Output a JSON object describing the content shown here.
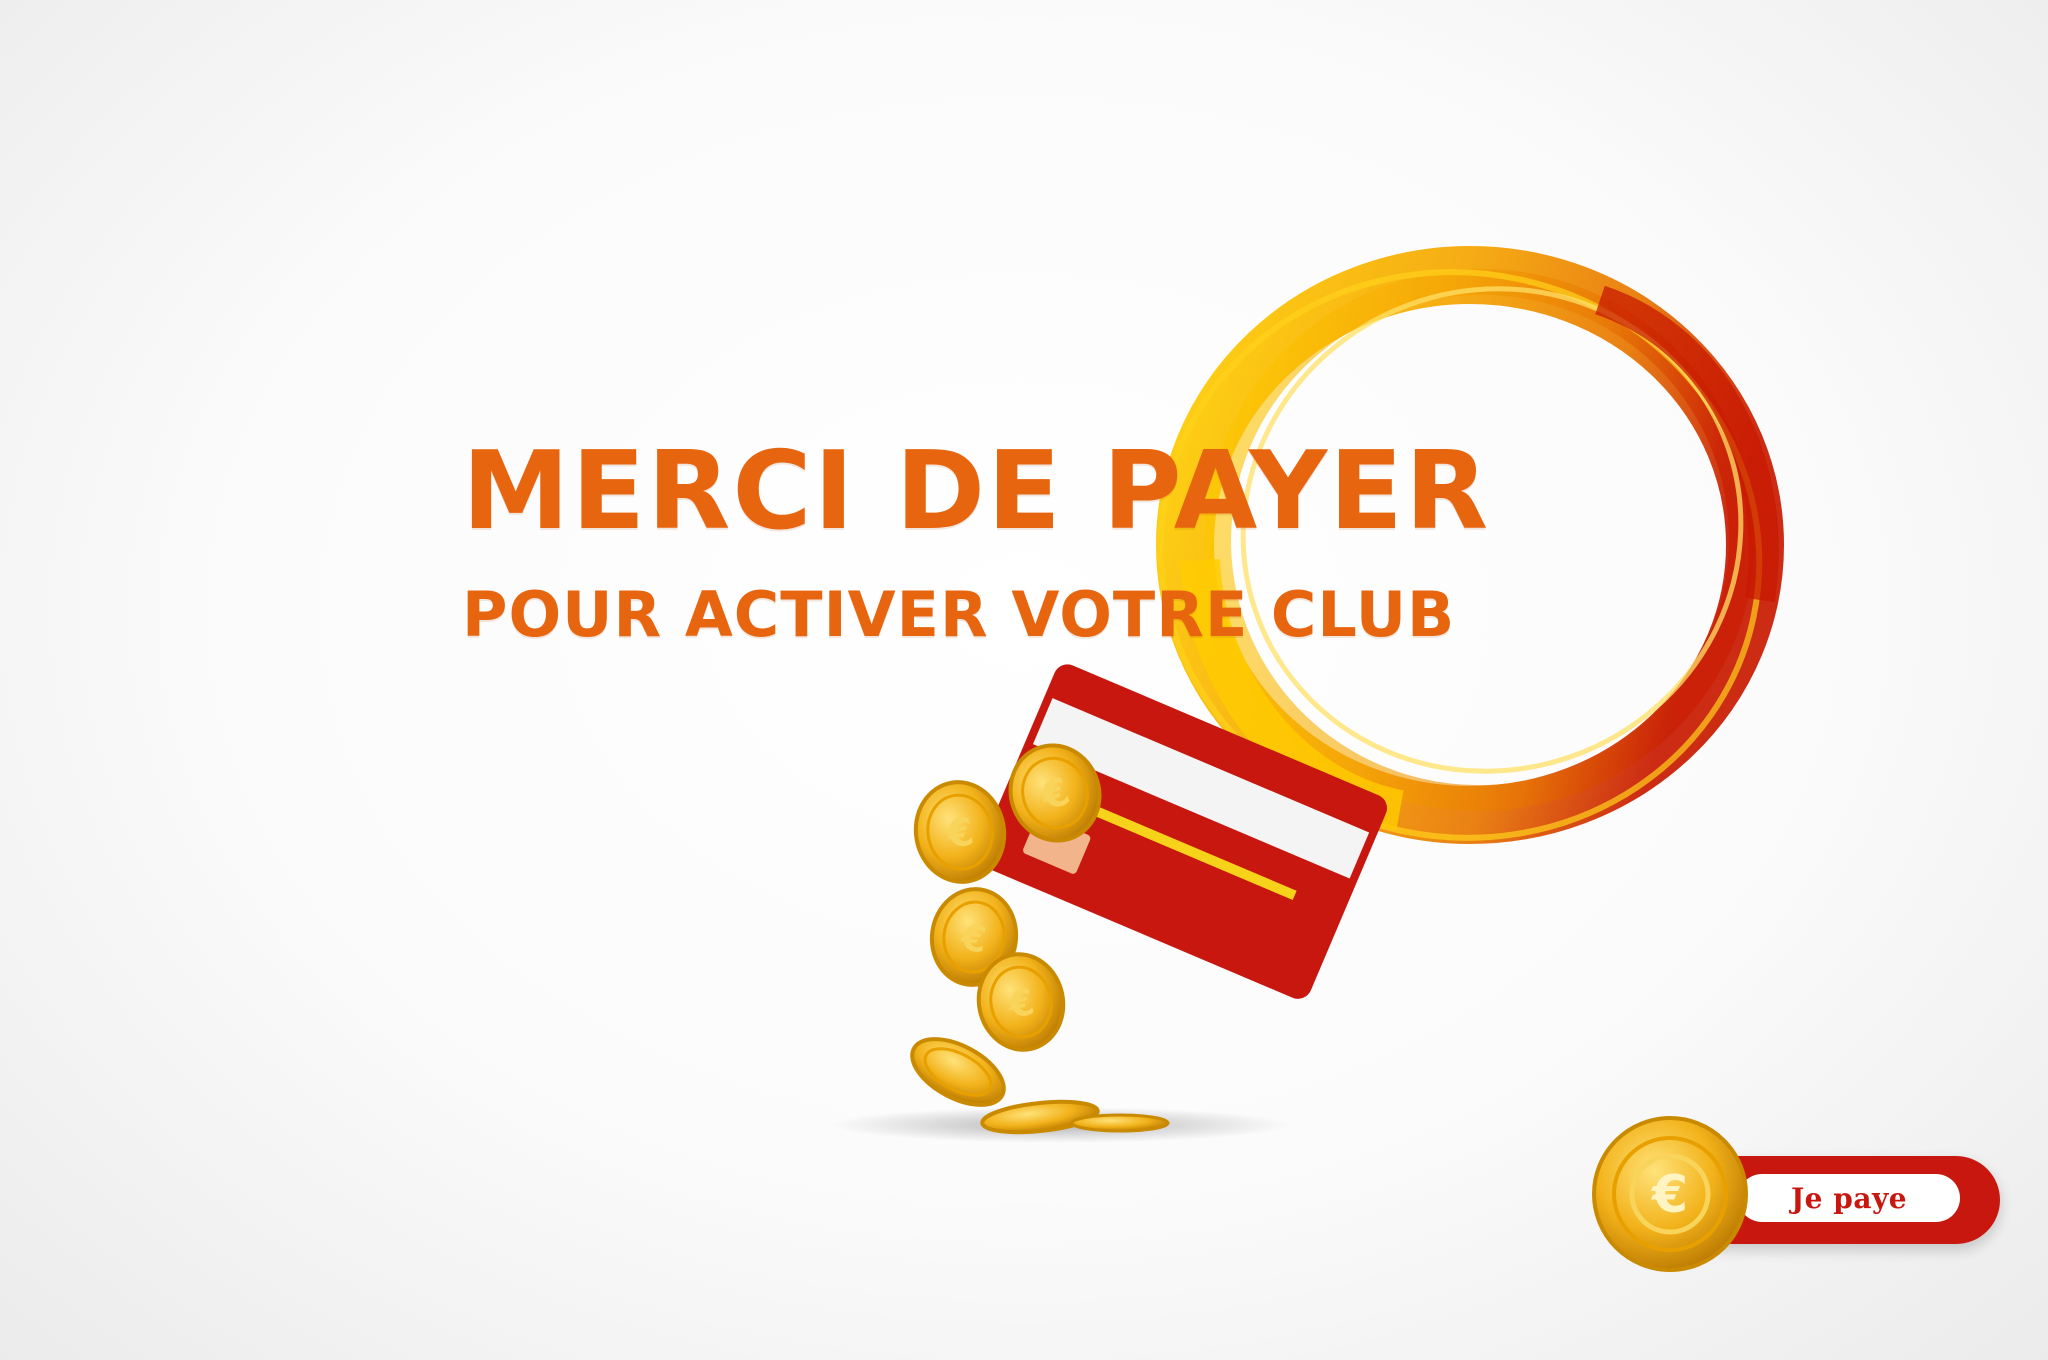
{
  "headline": "MERCI DE PAYER",
  "subline": "POUR ACTIVER VOTRE CLUB",
  "pay_button": {
    "label": "Je paye",
    "icon": "euro-coin-icon"
  },
  "colors": {
    "text_orange": "#e8650f",
    "card_red": "#c8170f",
    "ring_yellow": "#f7c600",
    "ring_red": "#d02a00",
    "coin_gold": "#f2b21a"
  }
}
